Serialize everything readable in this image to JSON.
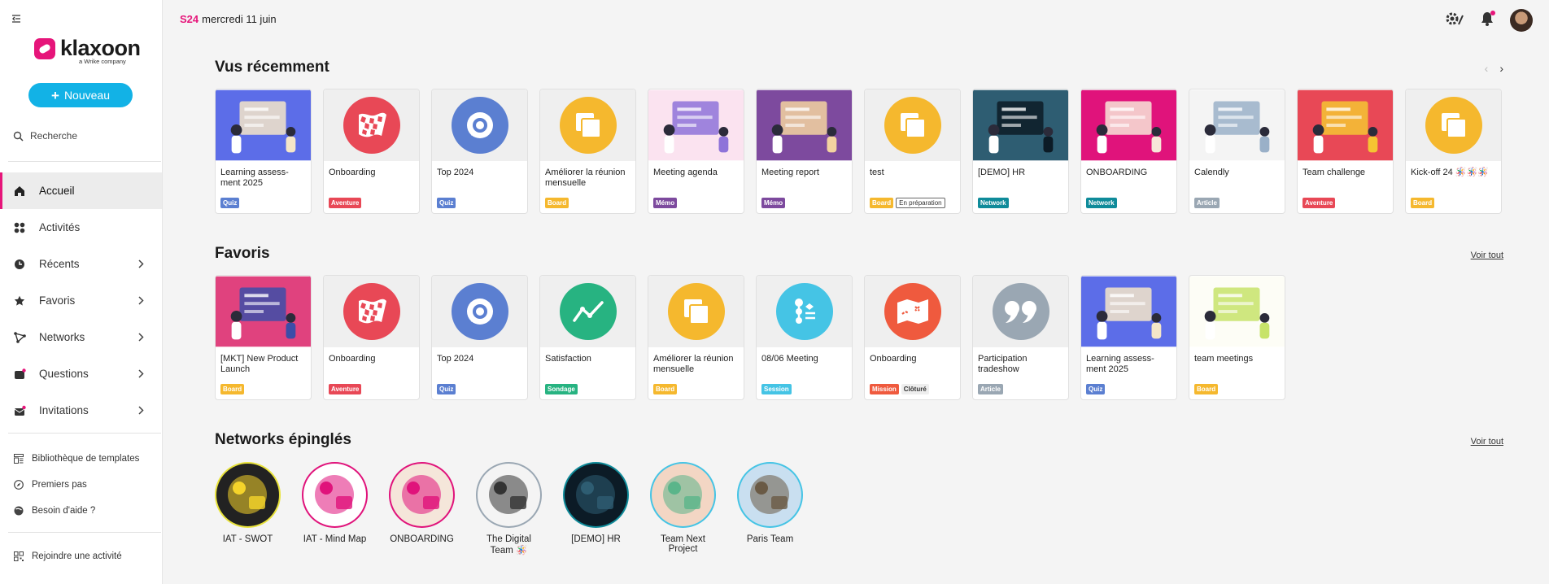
{
  "sidebar": {
    "logo_text": "klaxoon",
    "logo_sub": "a Wrike company",
    "new_button": "Nouveau",
    "search": "Recherche",
    "nav": [
      {
        "label": "Accueil",
        "icon": "home-icon",
        "chevron": false,
        "active": true
      },
      {
        "label": "Activités",
        "icon": "grid-icon",
        "chevron": false,
        "active": false
      },
      {
        "label": "Récents",
        "icon": "clock-icon",
        "chevron": true,
        "active": false
      },
      {
        "label": "Favoris",
        "icon": "star-icon",
        "chevron": true,
        "active": false
      },
      {
        "label": "Networks",
        "icon": "network-icon",
        "chevron": true,
        "active": false
      },
      {
        "label": "Questions",
        "icon": "question-icon",
        "chevron": true,
        "active": false
      },
      {
        "label": "Invitations",
        "icon": "mail-icon",
        "chevron": true,
        "active": false
      }
    ],
    "footer": [
      {
        "label": "Bibliothèque de templates",
        "icon": "template-icon"
      },
      {
        "label": "Premiers pas",
        "icon": "compass-icon"
      },
      {
        "label": "Besoin d'aide ?",
        "icon": "help-icon"
      }
    ],
    "join": {
      "label": "Rejoindre une activité",
      "icon": "qr-icon"
    }
  },
  "topbar": {
    "week": "S24",
    "date": "mercredi 11 juin"
  },
  "sections": {
    "recent": "Vus récemment",
    "favorites": "Favoris",
    "networks": "Networks épinglés",
    "see_all": "Voir tout"
  },
  "colors": {
    "accent": "#e6157a",
    "new_button": "#12b2e6",
    "Quiz": "#5b7fd1",
    "Aventure": "#e84856",
    "Board": "#f5b82e",
    "Mémo": "#7d4a9e",
    "Network": "#0f8b9a",
    "Article": "#9aa7b3",
    "Sondage": "#27b381",
    "Session": "#45c4e5",
    "Mission": "#ef5a3e"
  },
  "recent": [
    {
      "title": "Learning assess-ment 2025",
      "tags": [
        {
          "t": "Quiz",
          "k": "Quiz"
        }
      ],
      "thumb": "illus",
      "bg": "#5c6de8",
      "fg": "#f5e6c8"
    },
    {
      "title": "Onboarding",
      "tags": [
        {
          "t": "Aventure",
          "k": "Aventure"
        }
      ],
      "thumb": "circle",
      "bg": "#e84856",
      "icon": "flag-icon"
    },
    {
      "title": "Top 2024",
      "tags": [
        {
          "t": "Quiz",
          "k": "Quiz"
        }
      ],
      "thumb": "circle",
      "bg": "#5b7fd1",
      "icon": "chat-icon"
    },
    {
      "title": "Améliorer la réunion mensuelle",
      "tags": [
        {
          "t": "Board",
          "k": "Board"
        }
      ],
      "thumb": "circle",
      "bg": "#f5b82e",
      "icon": "board-icon"
    },
    {
      "title": "Meeting agenda",
      "tags": [
        {
          "t": "Mémo",
          "k": "Mémo"
        }
      ],
      "thumb": "illus",
      "bg": "#fbe3f0",
      "fg": "#8e73d9"
    },
    {
      "title": "Meeting report",
      "tags": [
        {
          "t": "Mémo",
          "k": "Mémo"
        }
      ],
      "thumb": "illus",
      "bg": "#7d4a9e",
      "fg": "#f3d3a0"
    },
    {
      "title": "test",
      "tags": [
        {
          "t": "Board",
          "k": "Board"
        },
        {
          "t": "En préparation",
          "k": "outline"
        }
      ],
      "thumb": "circle",
      "bg": "#f5b82e",
      "icon": "board-icon"
    },
    {
      "title": "[DEMO] HR",
      "tags": [
        {
          "t": "Network",
          "k": "Network"
        }
      ],
      "thumb": "illus",
      "bg": "#2e5d72",
      "fg": "#0c1b26"
    },
    {
      "title": "ONBOARDING",
      "tags": [
        {
          "t": "Network",
          "k": "Network"
        }
      ],
      "thumb": "illus",
      "bg": "#e0137b",
      "fg": "#f7e6d8"
    },
    {
      "title": "Calendly",
      "tags": [
        {
          "t": "Article",
          "k": "Article"
        }
      ],
      "thumb": "illus",
      "bg": "#f4f4f4",
      "fg": "#9ab0c8"
    },
    {
      "title": "Team challenge",
      "tags": [
        {
          "t": "Aventure",
          "k": "Aventure"
        }
      ],
      "thumb": "illus",
      "bg": "#e84856",
      "fg": "#f5c532"
    },
    {
      "title": "Kick-off 24 🪅🪅🪅",
      "tags": [
        {
          "t": "Board",
          "k": "Board"
        }
      ],
      "thumb": "circle",
      "bg": "#f5b82e",
      "icon": "board-icon"
    }
  ],
  "favorites": [
    {
      "title": "[MKT] New Product Launch",
      "tags": [
        {
          "t": "Board",
          "k": "Board"
        }
      ],
      "thumb": "illus",
      "bg": "#e0427e",
      "fg": "#3c4da8"
    },
    {
      "title": "Onboarding",
      "tags": [
        {
          "t": "Aventure",
          "k": "Aventure"
        }
      ],
      "thumb": "circle",
      "bg": "#e84856",
      "icon": "flag-icon"
    },
    {
      "title": "Top 2024",
      "tags": [
        {
          "t": "Quiz",
          "k": "Quiz"
        }
      ],
      "thumb": "circle",
      "bg": "#5b7fd1",
      "icon": "chat-icon"
    },
    {
      "title": "Satisfaction",
      "tags": [
        {
          "t": "Sondage",
          "k": "Sondage"
        }
      ],
      "thumb": "circle",
      "bg": "#27b381",
      "icon": "line-chart-icon"
    },
    {
      "title": "Améliorer la réunion mensuelle",
      "tags": [
        {
          "t": "Board",
          "k": "Board"
        }
      ],
      "thumb": "circle",
      "bg": "#f5b82e",
      "icon": "board-icon"
    },
    {
      "title": "08/06 Meeting",
      "tags": [
        {
          "t": "Session",
          "k": "Session"
        }
      ],
      "thumb": "circle",
      "bg": "#45c4e5",
      "icon": "session-icon"
    },
    {
      "title": "Onboarding",
      "tags": [
        {
          "t": "Mission",
          "k": "Mission"
        },
        {
          "t": "Clôturé",
          "k": "plain"
        }
      ],
      "thumb": "circle",
      "bg": "#ef5a3e",
      "icon": "map-icon"
    },
    {
      "title": "Participation tradeshow",
      "tags": [
        {
          "t": "Article",
          "k": "Article"
        }
      ],
      "thumb": "circle",
      "bg": "#9aa7b3",
      "icon": "quote-icon"
    },
    {
      "title": "Learning assess-ment 2025",
      "tags": [
        {
          "t": "Quiz",
          "k": "Quiz"
        }
      ],
      "thumb": "illus",
      "bg": "#5c6de8",
      "fg": "#f5e6c8"
    },
    {
      "title": "team meetings",
      "tags": [
        {
          "t": "Board",
          "k": "Board"
        }
      ],
      "thumb": "illus",
      "bg": "#fdfdf6",
      "fg": "#c7e36a"
    }
  ],
  "networks": [
    {
      "label": "IAT - SWOT",
      "bg": "#222",
      "fg": "#f5d42a",
      "ring": "#e8e23a"
    },
    {
      "label": "IAT - Mind Map",
      "bg": "#fff",
      "fg": "#e0137b",
      "ring": "#e0137b"
    },
    {
      "label": "ONBOARDING",
      "bg": "#f5e6da",
      "fg": "#e0137b",
      "ring": "#e0137b"
    },
    {
      "label": "The Digital Team 🪅",
      "bg": "#f4f4f4",
      "fg": "#333",
      "ring": "#9aa7b3"
    },
    {
      "label": "[DEMO] HR",
      "bg": "#0c1b26",
      "fg": "#2e5d72",
      "ring": "#0f8b9a"
    },
    {
      "label": "Team Next Project",
      "bg": "#f3d6c4",
      "fg": "#5ab58a",
      "ring": "#45c4e5"
    },
    {
      "label": "Paris Team",
      "bg": "#c9dff0",
      "fg": "#6a5a45",
      "ring": "#45c4e5"
    }
  ]
}
